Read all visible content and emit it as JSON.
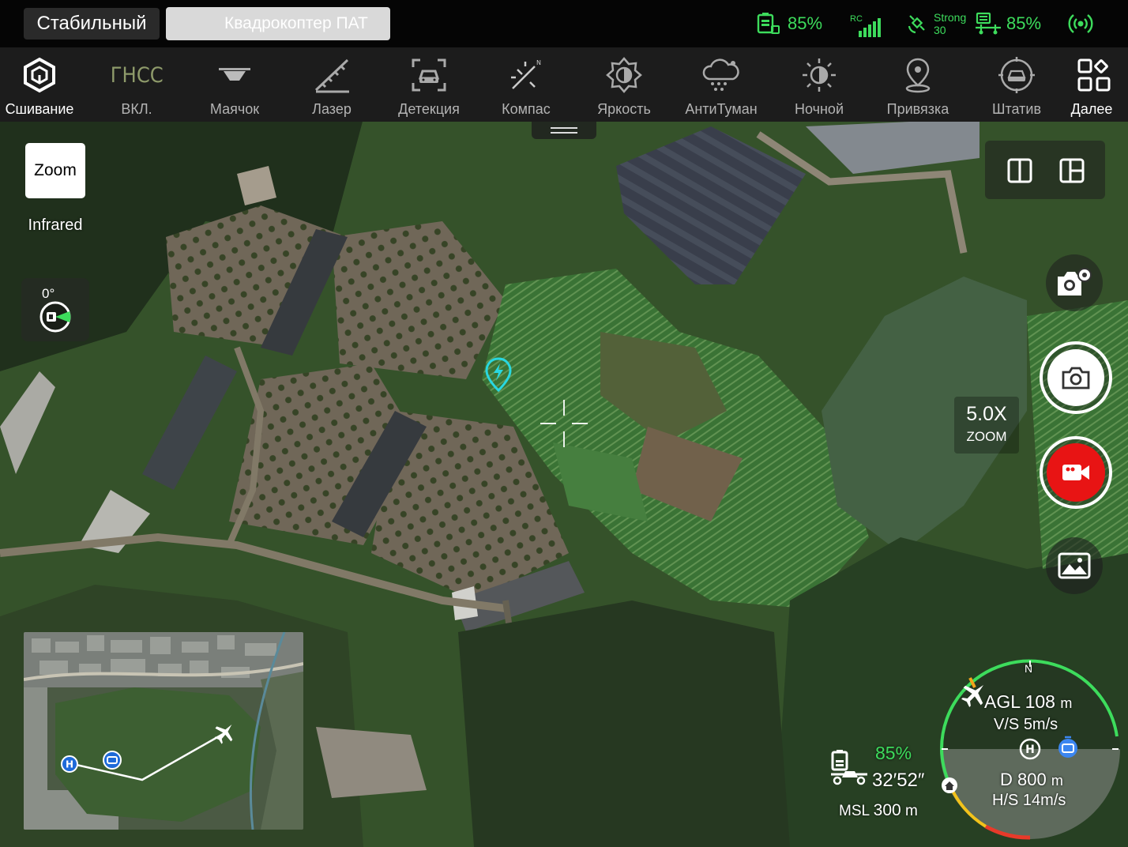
{
  "status_bar": {
    "flight_mode": "Стабильный",
    "device_name": "Квадрокоптер ПАТ",
    "rc_battery": "85%",
    "rc_signal_label": "RC",
    "gps_strength": "Strong",
    "gps_satellites": "30",
    "aircraft_battery": "85%",
    "accent_color": "#3ddc5c"
  },
  "toolbar": {
    "items": [
      {
        "label": "Сшивание",
        "icon": "stitch-cube-icon"
      },
      {
        "label": "ВКЛ.",
        "icon": "gnss-icon",
        "icon_text": "ГНСС"
      },
      {
        "label": "Маячок",
        "icon": "beacon-icon"
      },
      {
        "label": "Лазер",
        "icon": "laser-ruler-icon"
      },
      {
        "label": "Детекция",
        "icon": "detection-car-icon"
      },
      {
        "label": "Компас",
        "icon": "compass-icon"
      },
      {
        "label": "Яркость",
        "icon": "brightness-icon"
      },
      {
        "label": "АнтиТуман",
        "icon": "defog-icon"
      },
      {
        "label": "Ночной",
        "icon": "night-mode-icon"
      },
      {
        "label": "Привязка",
        "icon": "pin-icon"
      },
      {
        "label": "Штатив",
        "icon": "tripod-icon"
      },
      {
        "label": "Далее",
        "icon": "more-grid-icon"
      }
    ]
  },
  "camera": {
    "lens_button": "Zoom",
    "lens_secondary": "Infrared",
    "gimbal_angle": "0°",
    "zoom_value": "5.0X",
    "zoom_label": "ZOOM",
    "record_color": "#e81414"
  },
  "telemetry": {
    "battery_percent": "85%",
    "flight_time": "32′52″",
    "msl_label": "MSL",
    "msl_value": "300",
    "msl_unit": "m",
    "agl_label": "AGL",
    "agl_value": "108",
    "agl_unit": "m",
    "vs_label": "V/S",
    "vs_value": "5m/s",
    "distance_label": "D",
    "distance_value": "800",
    "distance_unit": "m",
    "hs_label": "H/S",
    "hs_value": "14m/s",
    "north_label": "N",
    "home_label": "H"
  }
}
